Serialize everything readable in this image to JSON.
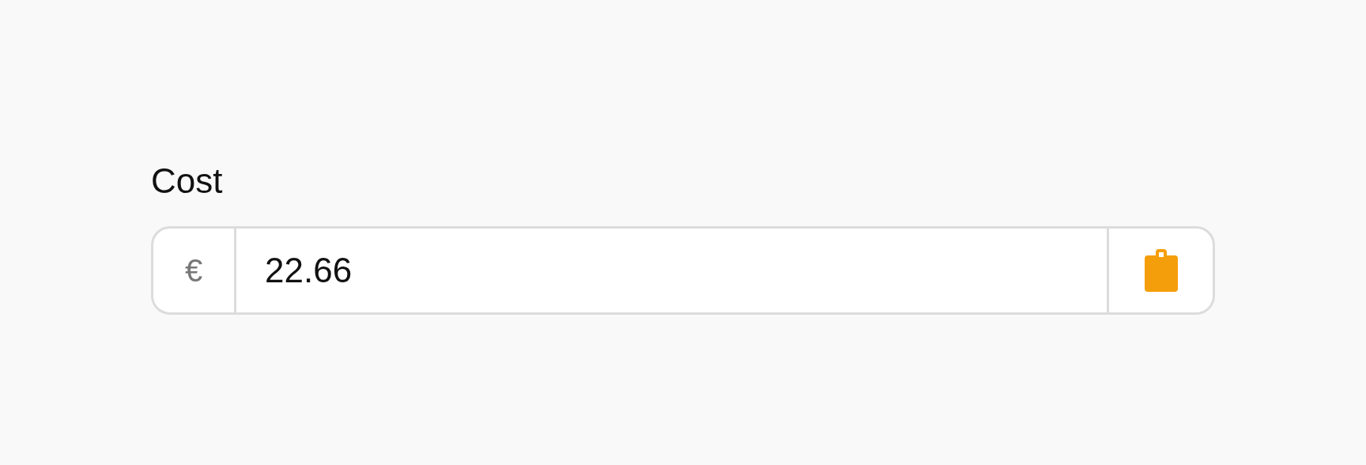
{
  "field": {
    "label": "Cost",
    "prefix": "€",
    "value": "22.66"
  }
}
